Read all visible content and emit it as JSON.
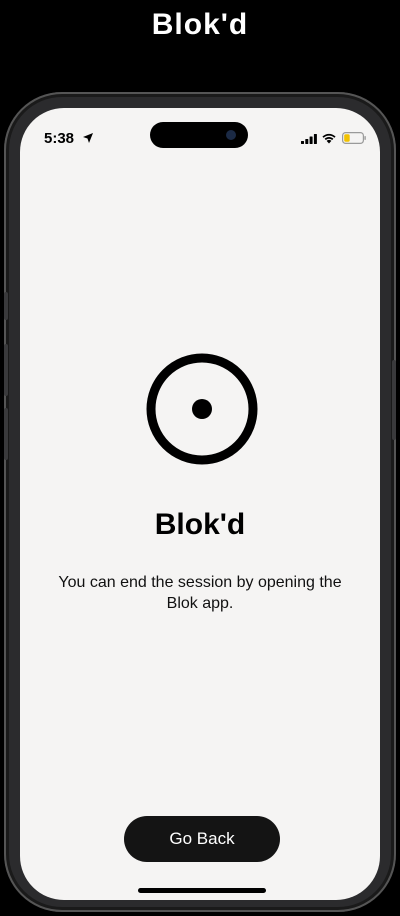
{
  "header_label": "Blok'd",
  "status_bar": {
    "time": "5:38",
    "icons": [
      "location-arrow-icon",
      "cellular-signal-icon",
      "wifi-icon",
      "battery-low-icon"
    ]
  },
  "screen": {
    "icon": "target-icon",
    "title": "Blok'd",
    "message": "You can end the session by opening the Blok app.",
    "button_label": "Go Back"
  },
  "colors": {
    "background": "#f5f4f3",
    "text": "#000000",
    "button_bg": "#141414",
    "button_text": "#ffffff",
    "battery": "#f2c200"
  }
}
